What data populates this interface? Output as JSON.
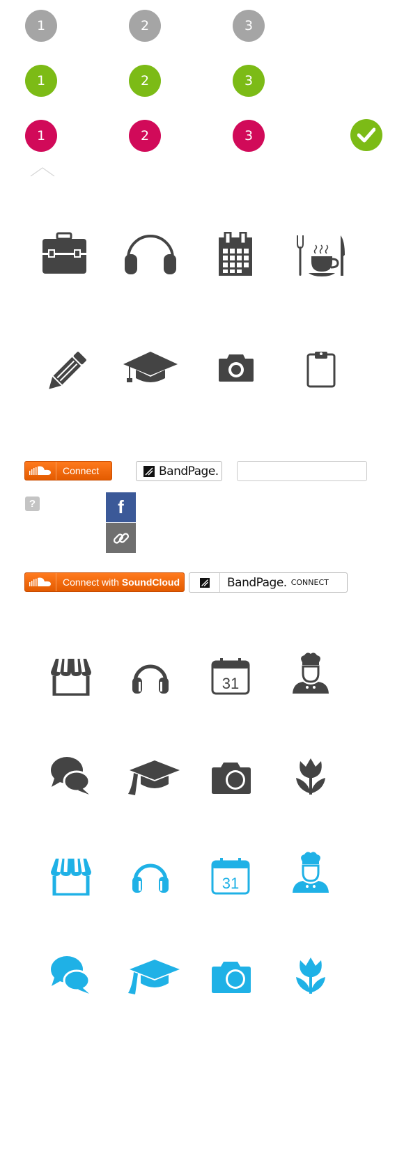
{
  "steps": {
    "gray": [
      "1",
      "2",
      "3"
    ],
    "green": [
      "1",
      "2",
      "3"
    ],
    "red": [
      "1",
      "2",
      "3"
    ]
  },
  "colors": {
    "gray": "#a5a5a5",
    "green": "#7cbb16",
    "red": "#d10a59",
    "icon_dark": "#444444",
    "icon_blue": "#1fb1e6",
    "soundcloud": "#ff6a00",
    "facebook": "#3b5998"
  },
  "icons_row1": [
    "briefcase-icon",
    "headphones-icon",
    "calendar-icon",
    "dining-icon"
  ],
  "icons_row2": [
    "pencil-icon",
    "graduation-cap-icon",
    "camera-icon",
    "clipboard-icon"
  ],
  "buttons": {
    "soundcloud_short": "Connect",
    "bandpage_short": "BandPage.",
    "soundcloud_long_prefix": "Connect with ",
    "soundcloud_long_brand": "SoundCloud",
    "bandpage_long": "BandPage.",
    "bandpage_long_suffix": "CONNECT"
  },
  "social": {
    "help": "?",
    "facebook": "f"
  },
  "icons_grid": {
    "dark_row1": [
      "store-icon",
      "headphones-icon",
      "calendar-icon",
      "chef-icon"
    ],
    "dark_row2": [
      "chat-icon",
      "graduation-cap-icon",
      "camera-icon",
      "tulip-icon"
    ],
    "blue_row1": [
      "store-icon",
      "headphones-icon",
      "calendar-icon",
      "chef-icon"
    ],
    "blue_row2": [
      "chat-icon",
      "graduation-cap-icon",
      "camera-icon",
      "tulip-icon"
    ],
    "calendar_day": "31"
  }
}
